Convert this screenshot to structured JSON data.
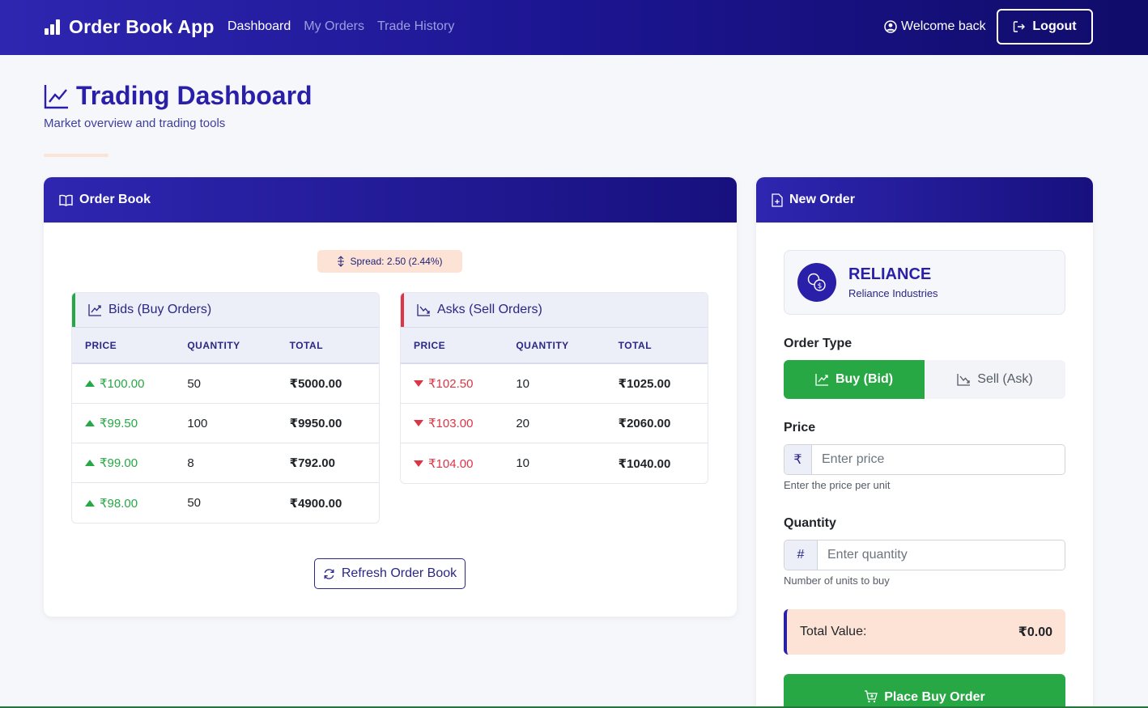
{
  "navbar": {
    "brand": "Order Book App",
    "links": [
      "Dashboard",
      "My Orders",
      "Trade History"
    ],
    "welcome": "Welcome back",
    "logout": "Logout"
  },
  "header": {
    "title": "Trading Dashboard",
    "subtitle": "Market overview and trading tools"
  },
  "order_book": {
    "title": "Order Book",
    "spread": "Spread: 2.50 (2.44%)",
    "columns": [
      "PRICE",
      "QUANTITY",
      "TOTAL"
    ],
    "bids_title": "Bids (Buy Orders)",
    "asks_title": "Asks (Sell Orders)",
    "bids": [
      {
        "price": "₹100.00",
        "quantity": "50",
        "total": "₹5000.00"
      },
      {
        "price": "₹99.50",
        "quantity": "100",
        "total": "₹9950.00"
      },
      {
        "price": "₹99.00",
        "quantity": "8",
        "total": "₹792.00"
      },
      {
        "price": "₹98.00",
        "quantity": "50",
        "total": "₹4900.00"
      }
    ],
    "asks": [
      {
        "price": "₹102.50",
        "quantity": "10",
        "total": "₹1025.00"
      },
      {
        "price": "₹103.00",
        "quantity": "20",
        "total": "₹2060.00"
      },
      {
        "price": "₹104.00",
        "quantity": "10",
        "total": "₹1040.00"
      }
    ],
    "refresh": "Refresh Order Book"
  },
  "new_order": {
    "title": "New Order",
    "stock_symbol": "RELIANCE",
    "stock_name": "Reliance Industries",
    "order_type_label": "Order Type",
    "buy_label": "Buy (Bid)",
    "sell_label": "Sell (Ask)",
    "price_label": "Price",
    "price_prefix": "₹",
    "price_placeholder": "Enter price",
    "price_help": "Enter the price per unit",
    "quantity_label": "Quantity",
    "quantity_prefix": "#",
    "quantity_placeholder": "Enter quantity",
    "quantity_help": "Number of units to buy",
    "total_label": "Total Value:",
    "total_value": "₹0.00",
    "submit": "Place Buy Order"
  },
  "colors": {
    "primary": "#2a1fa8",
    "buy": "#28a745",
    "sell": "#dc3545",
    "accent_peach": "#fde3d6"
  }
}
